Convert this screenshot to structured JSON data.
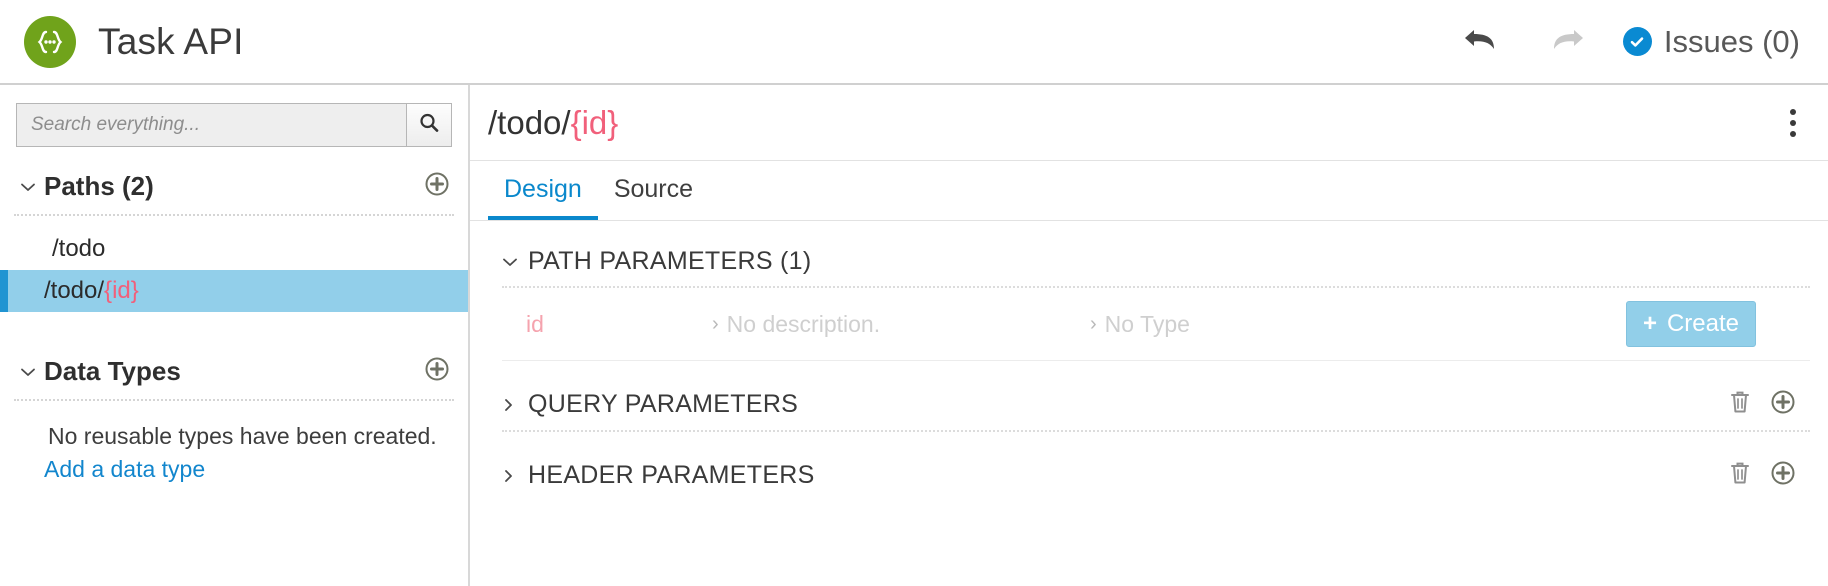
{
  "app": {
    "title": "Task API",
    "logo_icon": "curly-braces-circle-logo"
  },
  "topbar": {
    "undo_icon": "undo-arrow-icon",
    "redo_icon": "redo-arrow-icon",
    "issues_label": "Issues (0)",
    "issues_status_icon": "check-circle-icon",
    "colors": {
      "logo_green": "#70a31b",
      "issues_blue": "#0a8ad2"
    }
  },
  "sidebar": {
    "search": {
      "placeholder": "Search everything...",
      "value": "",
      "button_icon": "search-icon"
    },
    "paths_section": {
      "title": "Paths (2)",
      "collapse_icon": "chevron-down-icon",
      "add_icon": "plus-circle-icon",
      "items": [
        {
          "prefix": "/todo",
          "param": "",
          "selected": false
        },
        {
          "prefix": "/todo/",
          "param": "{id}",
          "selected": true
        }
      ]
    },
    "data_types_section": {
      "title": "Data Types",
      "collapse_icon": "chevron-down-icon",
      "add_icon": "plus-circle-icon",
      "empty_message": "No reusable types have been created.",
      "add_link": "Add a data type"
    }
  },
  "main": {
    "title_prefix": "/todo/",
    "title_param": "{id}",
    "menu_icon": "kebab-menu-icon",
    "tabs": [
      {
        "label": "Design",
        "active": true
      },
      {
        "label": "Source",
        "active": false
      }
    ],
    "sections": [
      {
        "title": "PATH PARAMETERS (1)",
        "collapse_icon": "chevron-down-icon",
        "expanded": true
      },
      {
        "title": "QUERY PARAMETERS",
        "collapse_icon": "chevron-right-icon",
        "expanded": false,
        "trash_icon": "trash-icon",
        "add_icon": "plus-circle-icon"
      },
      {
        "title": "HEADER PARAMETERS",
        "collapse_icon": "chevron-right-icon",
        "expanded": false,
        "trash_icon": "trash-icon",
        "add_icon": "plus-circle-icon"
      }
    ],
    "path_parameters": {
      "rows": [
        {
          "name": "id",
          "description": "No description.",
          "type": "No Type",
          "desc_chevron": "chevron-right-icon",
          "type_chevron": "chevron-right-icon",
          "create_label": "Create",
          "create_icon": "plus-icon"
        }
      ]
    },
    "colors": {
      "active_tab": "#0a88cc",
      "param_red": "#f1607b",
      "create_blue": "#92cfe9"
    }
  }
}
